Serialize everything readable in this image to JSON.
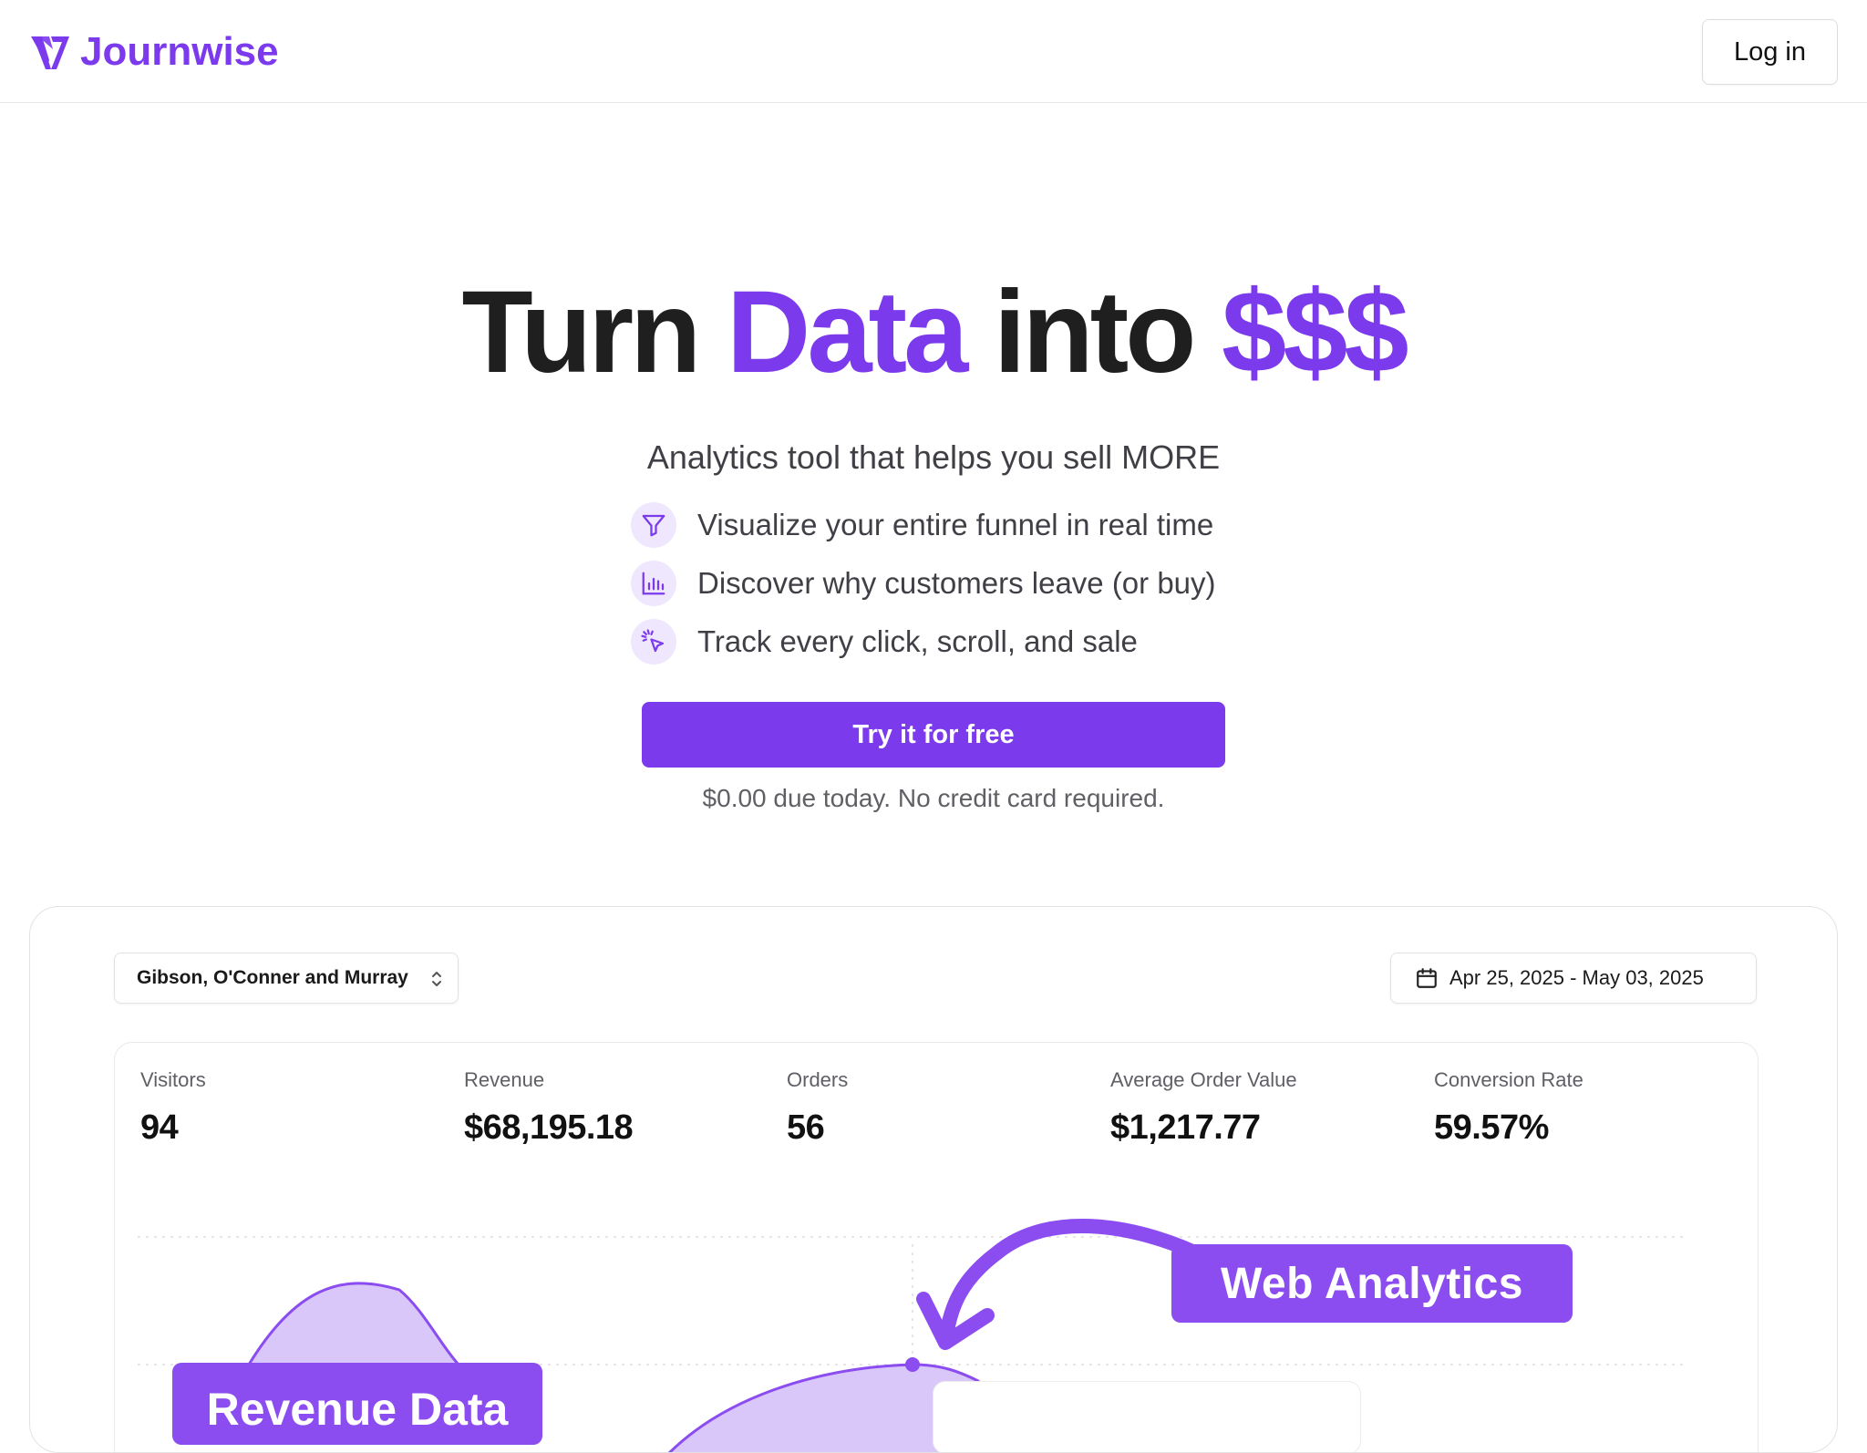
{
  "header": {
    "brand_name": "Journwise",
    "login_label": "Log in",
    "brand_color": "#7c3aed"
  },
  "hero": {
    "title_part1": "Turn",
    "title_accent1": "Data",
    "title_part2": "into",
    "title_accent2": "$$$",
    "subtitle": "Analytics tool that helps you sell MORE",
    "features": [
      {
        "icon": "funnel-icon",
        "text": "Visualize your entire funnel in real time"
      },
      {
        "icon": "bar-chart-icon",
        "text": "Discover why customers leave (or buy)"
      },
      {
        "icon": "cursor-click-icon",
        "text": "Track every click, scroll, and sale"
      }
    ],
    "cta_label": "Try it for free",
    "cta_note": "$0.00 due today. No credit card required."
  },
  "preview": {
    "store_name": "Gibson, O'Conner and Murray",
    "date_range": "Apr 25, 2025 - May 03, 2025",
    "stats": [
      {
        "label": "Visitors",
        "value": "94"
      },
      {
        "label": "Revenue",
        "value": "$68,195.18"
      },
      {
        "label": "Orders",
        "value": "56"
      },
      {
        "label": "Average Order Value",
        "value": "$1,217.77"
      },
      {
        "label": "Conversion Rate",
        "value": "59.57%"
      }
    ],
    "badge_web": "Web Analytics",
    "badge_revenue": "Revenue Data"
  }
}
